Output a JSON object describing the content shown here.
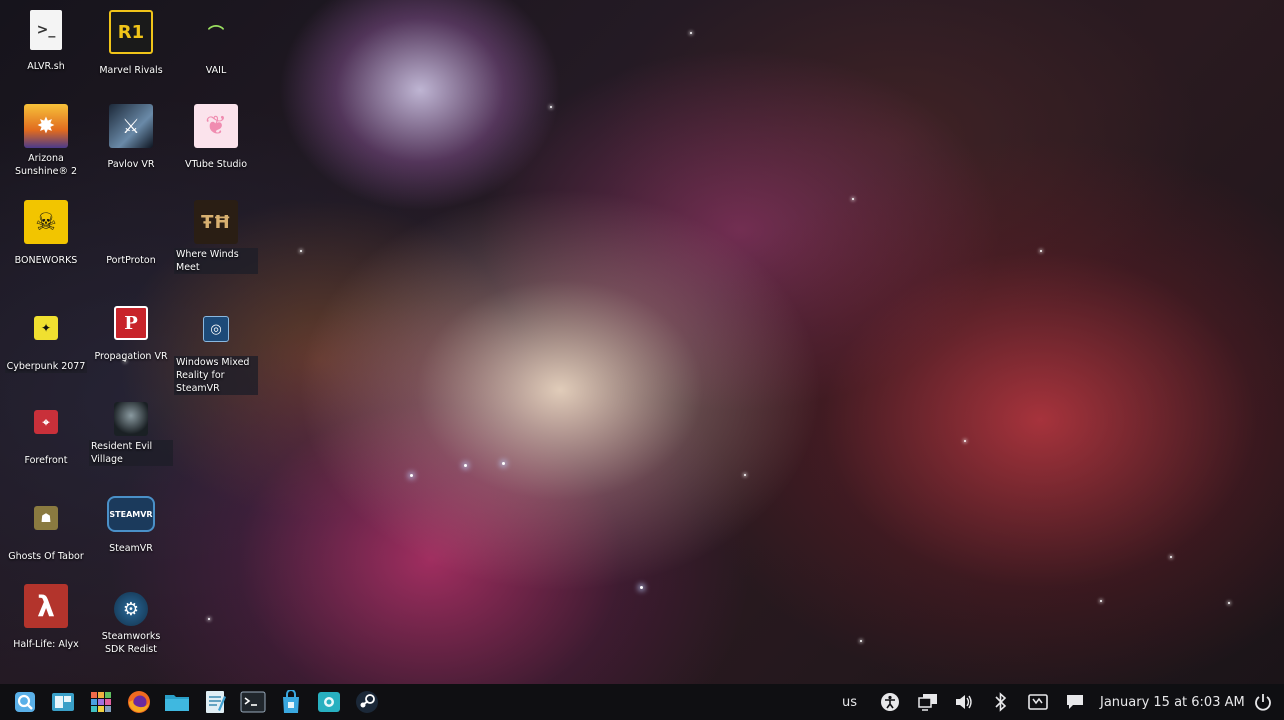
{
  "desktop": {
    "icons": [
      {
        "label": "ALVR.sh",
        "icon": "script-file-icon"
      },
      {
        "label": "Marvel Rivals",
        "icon": "marvel-rivals-icon"
      },
      {
        "label": "VAIL",
        "icon": "vail-icon"
      },
      {
        "label": "Arizona Sunshine® 2",
        "icon": "arizona-sunshine-icon"
      },
      {
        "label": "Pavlov VR",
        "icon": "pavlov-vr-icon"
      },
      {
        "label": "VTube Studio",
        "icon": "vtube-studio-icon"
      },
      {
        "label": "BONEWORKS",
        "icon": "boneworks-skull-icon"
      },
      {
        "label": "PortProton",
        "icon": "portproton-icon"
      },
      {
        "label": "Where Winds Meet",
        "icon": "where-winds-meet-icon"
      },
      {
        "label": "Cyberpunk 2077",
        "icon": "cyberpunk-icon"
      },
      {
        "label": "Propagation VR",
        "icon": "propagation-vr-icon"
      },
      {
        "label": "Windows Mixed Reality for SteamVR",
        "icon": "windows-mixed-reality-icon"
      },
      {
        "label": "Forefront",
        "icon": "forefront-icon"
      },
      {
        "label": "Resident Evil Village",
        "icon": "resident-evil-icon"
      },
      {
        "label": "Ghosts Of Tabor",
        "icon": "ghosts-of-tabor-icon"
      },
      {
        "label": "SteamVR",
        "icon": "steamvr-icon"
      },
      {
        "label": "Half-Life: Alyx",
        "icon": "half-life-lambda-icon"
      },
      {
        "label": "Steamworks SDK Redist",
        "icon": "steam-icon"
      }
    ],
    "icon_text": {
      "marvel": "R1",
      "propagation": "P",
      "halflife": "λ",
      "steamvr": "STEAMVR",
      "wmr": "◎",
      "wherewinds": "ŦĦ"
    }
  },
  "taskbar": {
    "apps": [
      "search-icon",
      "window-switcher-icon",
      "app-grid-icon",
      "firefox-icon",
      "file-manager-icon",
      "text-editor-icon",
      "terminal-icon",
      "store-icon",
      "screenshot-icon",
      "steam-icon"
    ],
    "keyboard_layout": "us",
    "clock": "January 15 at 6:03 AM",
    "tray_icons": [
      "accessibility-icon",
      "display-icon",
      "volume-icon",
      "bluetooth-icon",
      "media-icon",
      "notifications-icon",
      "power-icon"
    ]
  },
  "colors": {
    "taskbar_bg": "#0f0f12",
    "accent": "#3fa9d5"
  }
}
